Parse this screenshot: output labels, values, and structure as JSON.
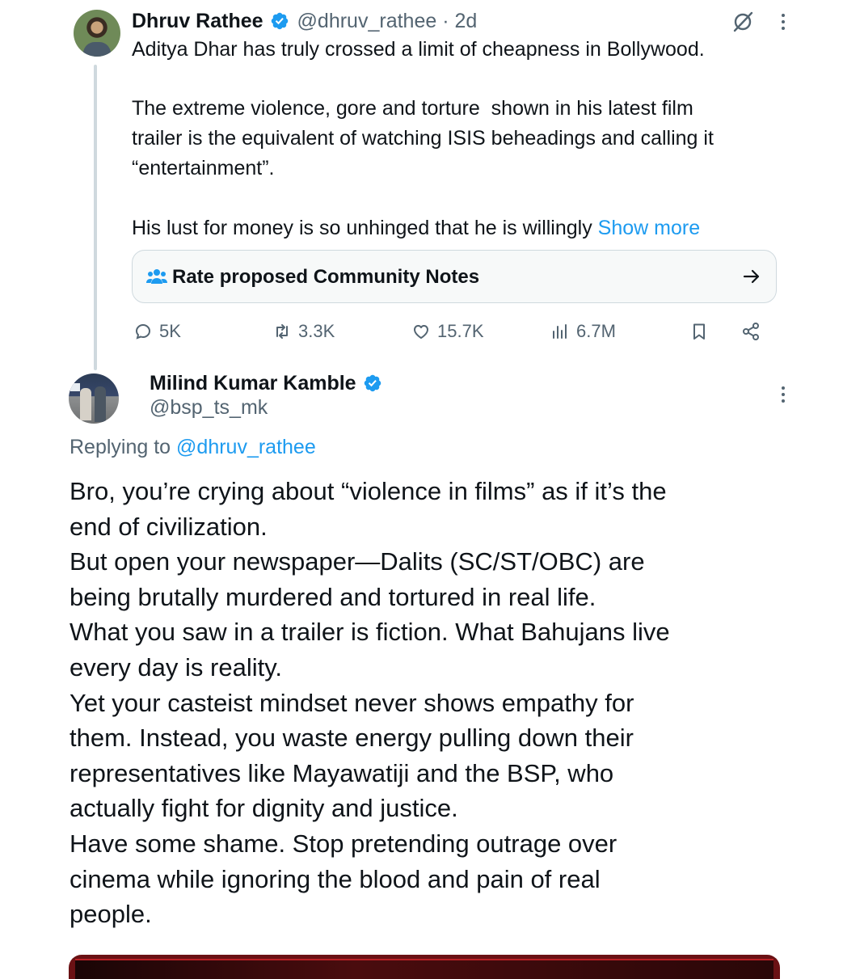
{
  "parent_tweet": {
    "author_name": "Dhruv Rathee",
    "handle_time": "@dhruv_rathee · 2d",
    "lines": [
      "Aditya Dhar has truly crossed a limit of cheapness in Bollywood.",
      "The extreme violence, gore and torture  shown in his latest film",
      "trailer is the equivalent of watching ISIS beheadings and calling it",
      "“entertainment”.",
      "His lust for money is so unhinged that he is willingly "
    ],
    "show_more": "Show more",
    "community_notes_label": "Rate proposed Community Notes",
    "actions": {
      "replies": "5K",
      "reposts": "3.3K",
      "likes": "15.7K",
      "views": "6.7M"
    }
  },
  "reply": {
    "author_name": "Milind Kumar Kamble",
    "handle": "@bsp_ts_mk",
    "replying_prefix": "Replying to ",
    "replying_to": "@dhruv_rathee",
    "lines": [
      "Bro, you’re crying about “violence in films” as if it’s the",
      "end of civilization.",
      "But open your newspaper—Dalits (SC/ST/OBC) are",
      "being brutally murdered and tortured in real life.",
      "What you saw in a trailer is fiction. What Bahujans live",
      "every day is reality.",
      "Yet your casteist mindset never shows empathy for",
      "them. Instead, you waste energy pulling down their",
      "representatives like Mayawatiji and the BSP, who",
      "actually fight for dignity and justice.",
      "Have some shame. Stop pretending outrage over",
      "cinema while ignoring the blood and pain of real",
      "people."
    ]
  },
  "colors": {
    "accent": "#1d9bf0",
    "text": "#0f1419",
    "muted": "#536471",
    "border": "#cfd9de"
  },
  "icons": {
    "verified": "verified-badge-icon",
    "grok": "grok-icon",
    "more": "more-vertical-icon",
    "community": "community-people-icon",
    "arrow": "arrow-right-icon",
    "reply": "reply-icon",
    "repost": "repost-icon",
    "like": "heart-icon",
    "views": "views-icon",
    "bookmark": "bookmark-icon",
    "share": "share-icon"
  }
}
